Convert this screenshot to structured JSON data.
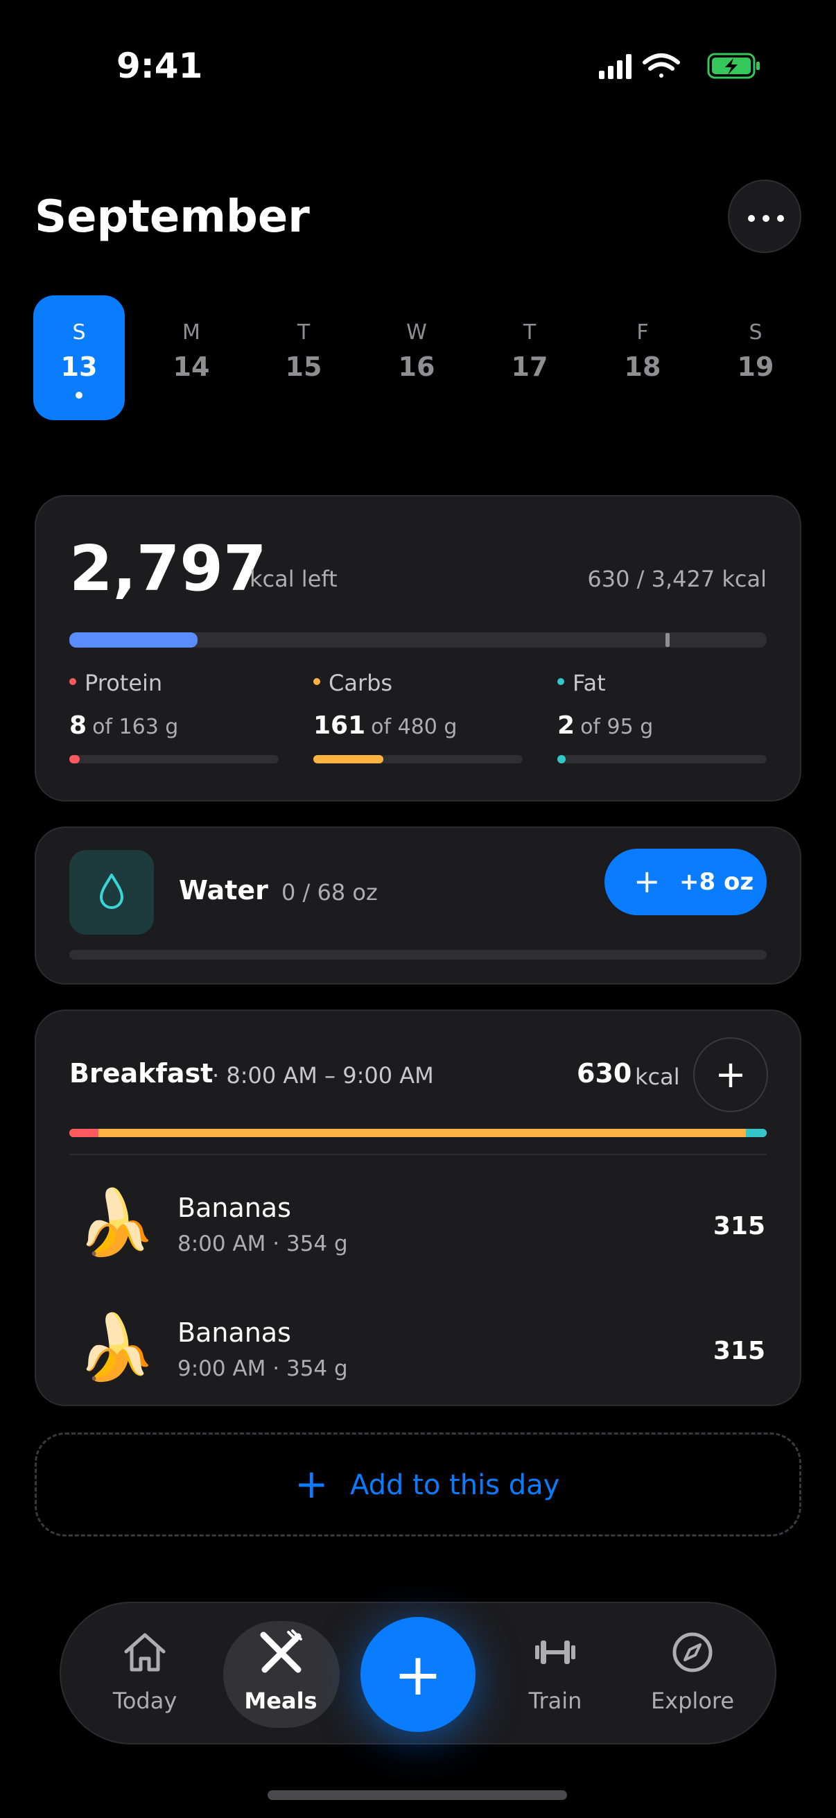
{
  "status": {
    "time": "9:41"
  },
  "header": {
    "month": "September"
  },
  "week": [
    {
      "letter": "S",
      "num": "13",
      "selected": true
    },
    {
      "letter": "M",
      "num": "14"
    },
    {
      "letter": "T",
      "num": "15"
    },
    {
      "letter": "W",
      "num": "16"
    },
    {
      "letter": "T",
      "num": "17"
    },
    {
      "letter": "F",
      "num": "18"
    },
    {
      "letter": "S",
      "num": "19"
    }
  ],
  "calories": {
    "left_value": "2,797",
    "left_label": "kcal left",
    "total": "630 / 3,427 kcal",
    "progress": 0.184
  },
  "macros": [
    {
      "name": "Protein",
      "value": "8",
      "of": "of 163 g",
      "color": "#ff5a5f",
      "progress": 0.049
    },
    {
      "name": "Carbs",
      "value": "161",
      "of": "of 480 g",
      "color": "#ffb340",
      "progress": 0.335
    },
    {
      "name": "Fat",
      "value": "2",
      "of": "of 95 g",
      "color": "#34c7c9",
      "progress": 0.021
    }
  ],
  "water": {
    "title": "Water",
    "amount": "0 / 68 oz",
    "button": "+8 oz"
  },
  "meal": {
    "title": "Breakfast",
    "time": "· 8:00 AM – 9:00 AM",
    "kcal": "630",
    "kcal_unit": "kcal",
    "items": [
      {
        "icon": "🍌",
        "name": "Bananas",
        "sub": "8:00 AM · 354 g",
        "kcal": "315"
      },
      {
        "icon": "🍌",
        "name": "Bananas",
        "sub": "9:00 AM · 354 g",
        "kcal": "315"
      }
    ]
  },
  "add_day": {
    "label": "Add to this day"
  },
  "tabs": [
    {
      "label": "Today",
      "icon": "home-icon"
    },
    {
      "label": "Meals",
      "icon": "utensils-icon",
      "active": true
    },
    {
      "label": "Train",
      "icon": "dumbbell-icon"
    },
    {
      "label": "Explore",
      "icon": "compass-icon"
    }
  ],
  "colors": {
    "accent": "#0a7cff",
    "calorie_bar": "#5b8cff"
  }
}
